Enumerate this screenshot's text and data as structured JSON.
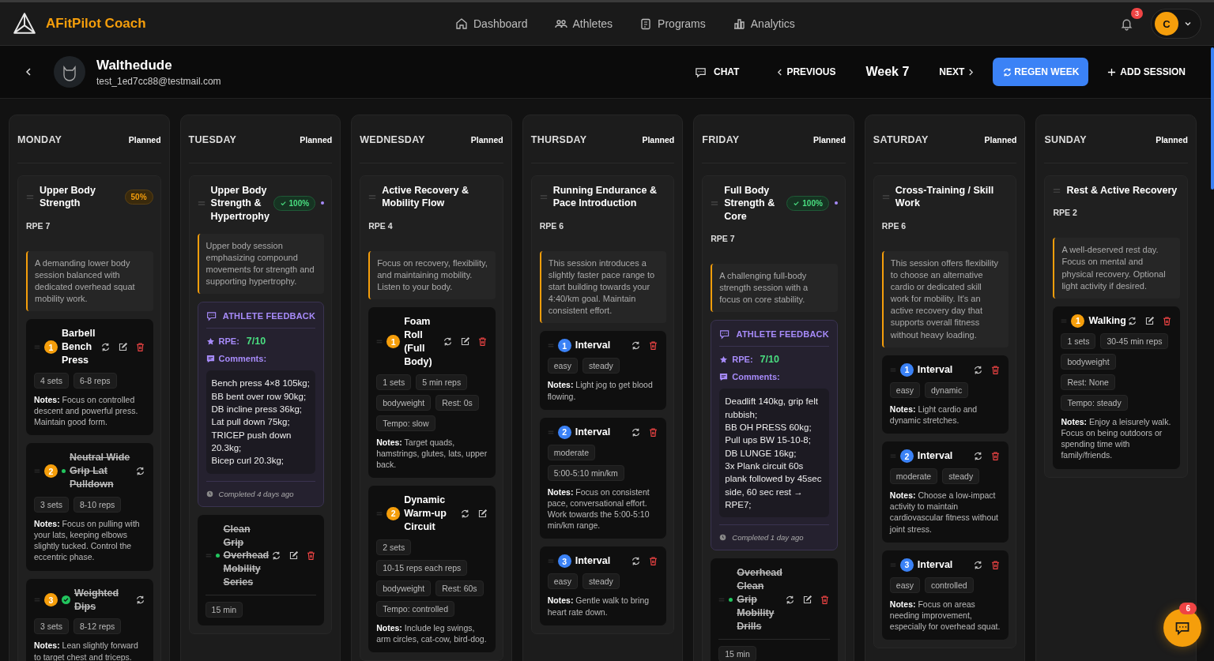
{
  "brand": {
    "name": "AFitPilot Coach"
  },
  "nav": [
    {
      "label": "Dashboard"
    },
    {
      "label": "Athletes"
    },
    {
      "label": "Programs"
    },
    {
      "label": "Analytics"
    }
  ],
  "notifications": {
    "count": "3"
  },
  "user": {
    "initial": "C"
  },
  "athlete": {
    "name": "Walthedude",
    "email": "test_1ed7cc88@testmail.com"
  },
  "week_bar": {
    "chat": "CHAT",
    "previous": "PREVIOUS",
    "week": "Week 7",
    "next": "NEXT",
    "regen": "REGEN WEEK",
    "add": "ADD SESSION"
  },
  "days": [
    {
      "day": "MONDAY",
      "status": "Planned",
      "sessions": [
        {
          "title": "Upper Body Strength",
          "completion": {
            "kind": "partial",
            "text": "50%"
          },
          "rpe": "RPE 7",
          "description": "A demanding lower body session balanced with dedicated overhead squat mobility work.",
          "exercises": [
            {
              "kind": "strength",
              "number": "1",
              "title": "Barbell Bench Press",
              "completed": false,
              "editable": true,
              "deletable": true,
              "tags": [
                "4 sets",
                "6-8 reps"
              ],
              "notes": "**Notes:** Focus on controlled descent and powerful press. Maintain good form."
            },
            {
              "kind": "strength",
              "number": "2",
              "title": "Neutral Wide Grip Lat Pulldown",
              "completed": true,
              "checked": false,
              "editable": false,
              "deletable": false,
              "tags": [
                "3 sets",
                "8-10 reps"
              ],
              "notes": "**Notes:** Focus on pulling with your lats, keeping elbows slightly tucked. Control the eccentric phase."
            },
            {
              "kind": "strength",
              "number": "3",
              "title": "Weighted Dips",
              "completed": true,
              "checked": true,
              "editable": false,
              "deletable": false,
              "tags": [
                "3 sets",
                "8-12 reps"
              ],
              "notes": "**Notes:** Lean slightly forward to target chest and triceps."
            }
          ]
        }
      ]
    },
    {
      "day": "TUESDAY",
      "status": "Planned",
      "sessions": [
        {
          "title": "Upper Body Strength & Hypertrophy",
          "completion": {
            "kind": "complete",
            "text": "100%"
          },
          "description": "Upper body session emphasizing compound movements for strength and supporting hypertrophy.",
          "feedback": {
            "heading": "ATHLETE FEEDBACK",
            "rpe_label": "RPE:",
            "rpe": "7/10",
            "comments_label": "Comments:",
            "comments": [
              "Bench press 4×8 105kg;",
              "BB bent over row 90kg;",
              "DB incline press 36kg;",
              "Lat pull down 75kg;",
              "TRICEP push down 20.3kg;",
              "Bicep curl 20.3kg;"
            ],
            "completed": "Completed 4 days ago"
          },
          "exercises": [
            {
              "kind": "timed",
              "title": "Clean Grip Overhead Mobility Series",
              "completed": true,
              "checked": false,
              "editable": true,
              "deletable": true,
              "tags": [
                "15 min"
              ]
            }
          ]
        }
      ]
    },
    {
      "day": "WEDNESDAY",
      "status": "Planned",
      "sessions": [
        {
          "title": "Active Recovery & Mobility Flow",
          "rpe": "RPE 4",
          "description": "Focus on recovery, flexibility, and maintaining mobility. Listen to your body.",
          "exercises": [
            {
              "kind": "strength",
              "number": "1",
              "title": "Foam Roll (Full Body)",
              "completed": false,
              "editable": true,
              "deletable": true,
              "tags": [
                "1 sets",
                "5 min reps",
                "bodyweight",
                "Rest: 0s",
                "Tempo: slow"
              ],
              "notes": "**Notes:** Target quads, hamstrings, glutes, lats, upper back."
            },
            {
              "kind": "strength",
              "number": "2",
              "title": "Dynamic Warm-up Circuit",
              "completed": false,
              "editable": true,
              "deletable": false,
              "tags": [
                "2 sets",
                "10-15 reps each reps",
                "bodyweight",
                "Rest: 60s",
                "Tempo: controlled"
              ],
              "notes": "**Notes:** Include leg swings, arm circles, cat-cow, bird-dog."
            }
          ]
        }
      ]
    },
    {
      "day": "THURSDAY",
      "status": "Planned",
      "sessions": [
        {
          "title": "Running Endurance & Pace Introduction",
          "rpe": "RPE 6",
          "description": "This session introduces a slightly faster pace range to start building towards your 4:40/km goal. Maintain consistent effort.",
          "exercises": [
            {
              "kind": "interval",
              "number": "1",
              "title": "Interval",
              "completed": false,
              "editable": false,
              "deletable": true,
              "tags": [
                "easy",
                "steady"
              ],
              "notes": "**Notes:** Light jog to get blood flowing."
            },
            {
              "kind": "interval",
              "number": "2",
              "title": "Interval",
              "completed": false,
              "editable": false,
              "deletable": true,
              "tags": [
                "moderate",
                "5:00-5:10 min/km"
              ],
              "notes": "**Notes:** Focus on consistent pace, conversational effort. Work towards the 5:00-5:10 min/km range."
            },
            {
              "kind": "interval",
              "number": "3",
              "title": "Interval",
              "completed": false,
              "editable": false,
              "deletable": true,
              "tags": [
                "easy",
                "steady"
              ],
              "notes": "**Notes:** Gentle walk to bring heart rate down."
            }
          ]
        }
      ]
    },
    {
      "day": "FRIDAY",
      "status": "Planned",
      "sessions": [
        {
          "title": "Full Body Strength & Core",
          "completion": {
            "kind": "complete",
            "text": "100%"
          },
          "rpe": "RPE 7",
          "description": "A challenging full-body strength session with a focus on core stability.",
          "feedback": {
            "heading": "ATHLETE FEEDBACK",
            "rpe_label": "RPE:",
            "rpe": "7/10",
            "comments_label": "Comments:",
            "comments": [
              "Deadlift 140kg, grip felt rubbish;",
              "BB OH PRESS 60kg;",
              "Pull ups BW 15-10-8;",
              "DB LUNGE 16kg;",
              "3x Plank circuit 60s plank followed by 45sec side, 60 sec rest → RPE7;"
            ],
            "completed": "Completed 1 day ago"
          },
          "exercises": [
            {
              "kind": "timed",
              "title": "Overhead Clean Grip Mobility Drills",
              "completed": true,
              "checked": false,
              "editable": true,
              "deletable": true,
              "tags": [
                "15 min"
              ]
            }
          ]
        }
      ]
    },
    {
      "day": "SATURDAY",
      "status": "Planned",
      "sessions": [
        {
          "title": "Cross-Training / Skill Work",
          "rpe": "RPE 6",
          "description": "This session offers flexibility to choose an alternative cardio or dedicated skill work for mobility. It's an active recovery day that supports overall fitness without heavy loading.",
          "exercises": [
            {
              "kind": "interval",
              "number": "1",
              "title": "Interval",
              "completed": false,
              "editable": false,
              "deletable": true,
              "tags": [
                "easy",
                "dynamic"
              ],
              "notes": "**Notes:** Light cardio and dynamic stretches."
            },
            {
              "kind": "interval",
              "number": "2",
              "title": "Interval",
              "completed": false,
              "editable": false,
              "deletable": true,
              "tags": [
                "moderate",
                "steady"
              ],
              "notes": "**Notes:** Choose a low-impact activity to maintain cardiovascular fitness without joint stress."
            },
            {
              "kind": "interval",
              "number": "3",
              "title": "Interval",
              "completed": false,
              "editable": false,
              "deletable": true,
              "tags": [
                "easy",
                "controlled"
              ],
              "notes": "**Notes:** Focus on areas needing improvement, especially for overhead squat."
            }
          ]
        }
      ]
    },
    {
      "day": "SUNDAY",
      "status": "Planned",
      "sessions": [
        {
          "title": "Rest & Active Recovery",
          "rpe": "RPE 2",
          "description": "A well-deserved rest day. Focus on mental and physical recovery. Optional light activity if desired.",
          "exercises": [
            {
              "kind": "strength",
              "number": "1",
              "title": "Walking",
              "completed": false,
              "editable": true,
              "deletable": true,
              "tags": [
                "1 sets",
                "30-45 min reps",
                "bodyweight",
                "Rest: None",
                "Tempo: steady"
              ],
              "notes": "**Notes:** Enjoy a leisurely walk. Focus on being outdoors or spending time with family/friends."
            }
          ]
        }
      ]
    }
  ],
  "chat_fab": {
    "count": "6"
  }
}
